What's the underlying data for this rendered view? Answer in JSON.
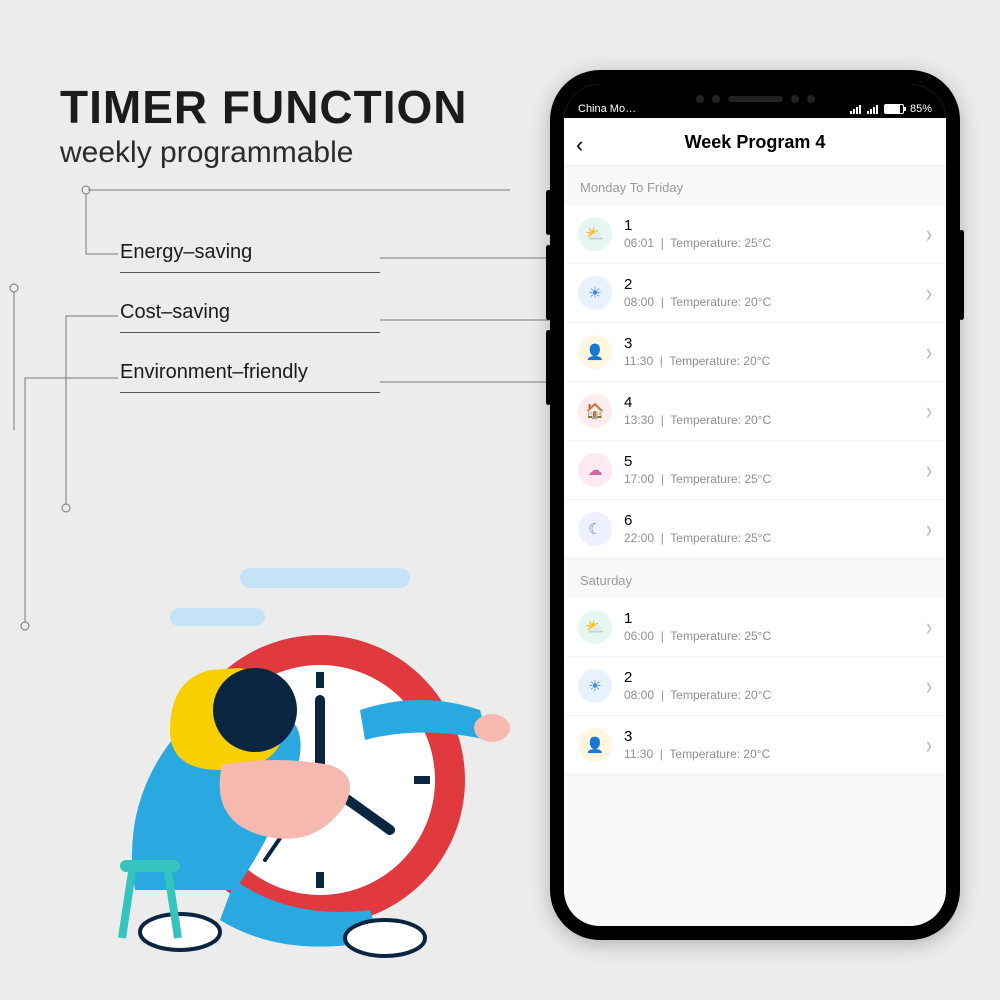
{
  "headline": {
    "title": "TIMER FUNCTION",
    "subtitle": "weekly programmable"
  },
  "bullets": [
    "Energy–saving",
    "Cost–saving",
    "Environment–friendly"
  ],
  "statusbar": {
    "carrier": "China Mo… ",
    "battery_pct": "85%"
  },
  "screen": {
    "title": "Week Program 4",
    "sections": [
      {
        "header": "Monday To Friday",
        "rows": [
          {
            "num": "1",
            "time": "06:01",
            "temp": "Temperature: 25°C",
            "icon": "sunrise"
          },
          {
            "num": "2",
            "time": "08:00",
            "temp": "Temperature: 20°C",
            "icon": "sun"
          },
          {
            "num": "3",
            "time": "11:30",
            "temp": "Temperature: 20°C",
            "icon": "person"
          },
          {
            "num": "4",
            "time": "13:30",
            "temp": "Temperature: 20°C",
            "icon": "home"
          },
          {
            "num": "5",
            "time": "17:00",
            "temp": "Temperature: 25°C",
            "icon": "cloud"
          },
          {
            "num": "6",
            "time": "22:00",
            "temp": "Temperature: 25°C",
            "icon": "moon"
          }
        ]
      },
      {
        "header": "Saturday",
        "rows": [
          {
            "num": "1",
            "time": "06:00",
            "temp": "Temperature: 25°C",
            "icon": "sunrise"
          },
          {
            "num": "2",
            "time": "08:00",
            "temp": "Temperature: 20°C",
            "icon": "sun"
          },
          {
            "num": "3",
            "time": "11:30",
            "temp": "Temperature: 20°C",
            "icon": "person"
          }
        ]
      }
    ]
  },
  "glyphs": {
    "sunrise": "⛅",
    "sun": "☀",
    "person": "👤",
    "home": "🏠",
    "cloud": "☁",
    "moon": "☾"
  }
}
